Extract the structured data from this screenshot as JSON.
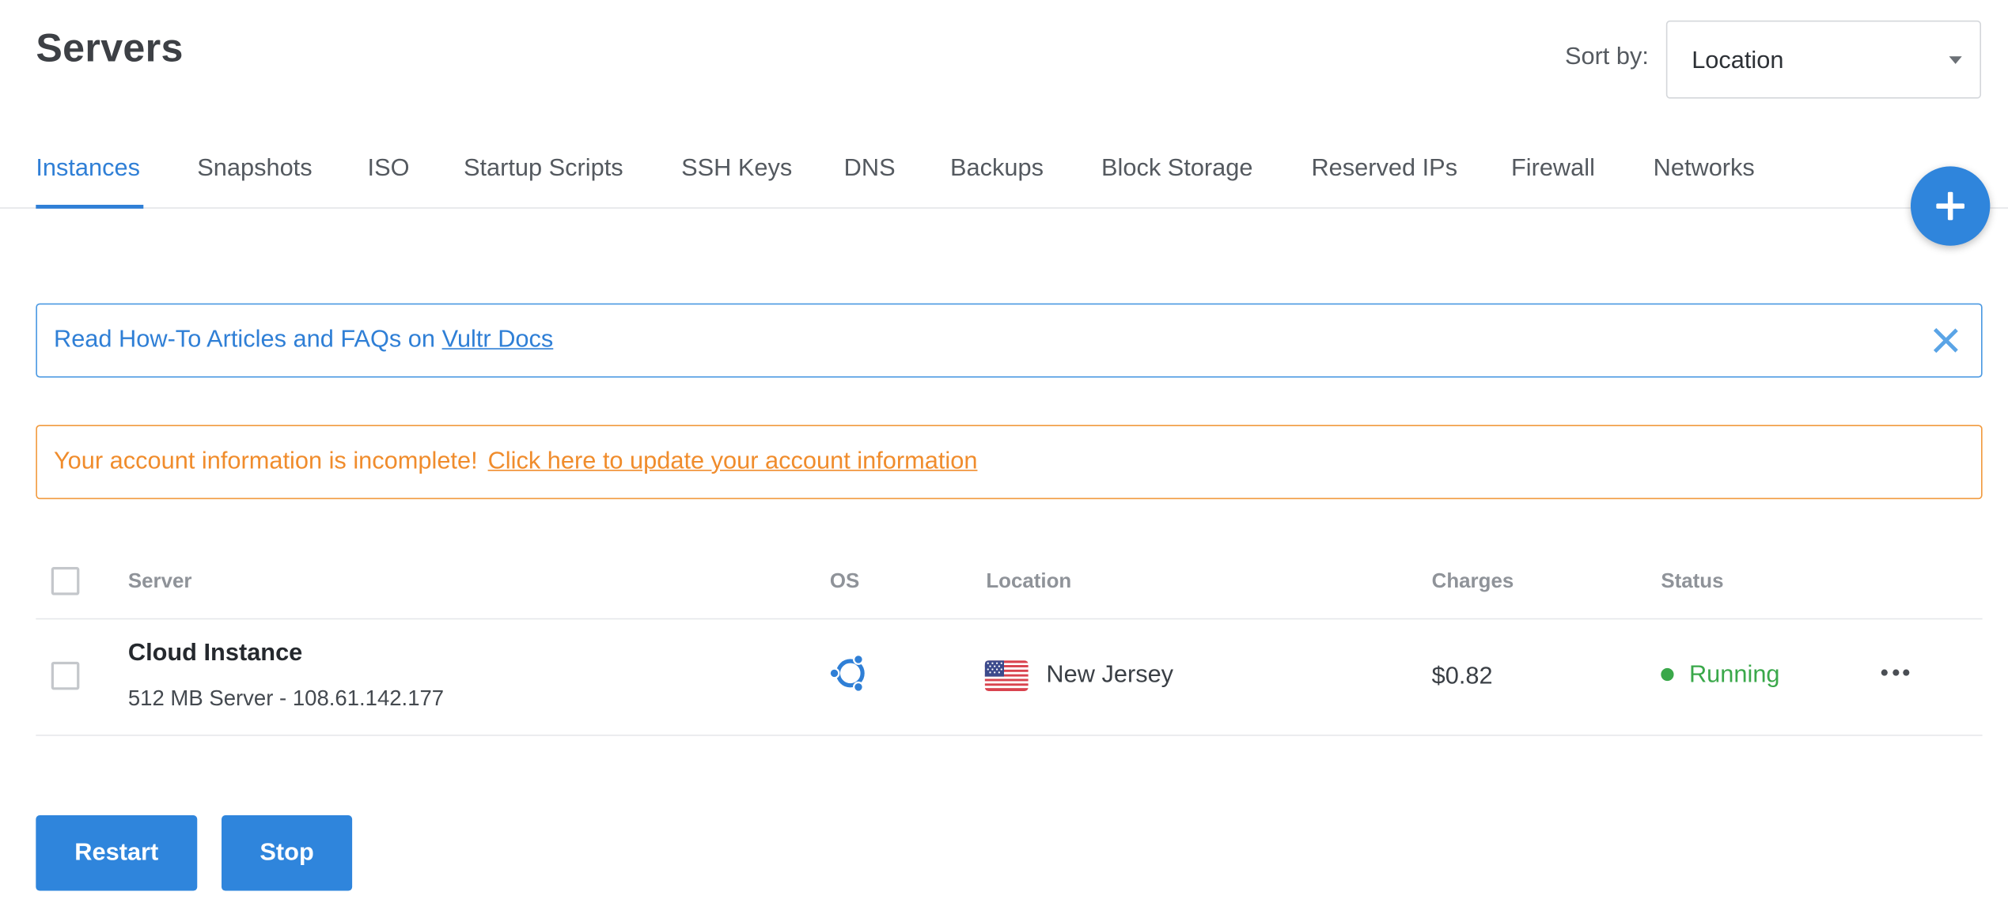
{
  "header": {
    "title": "Servers",
    "sort_label": "Sort by:",
    "sort_value": "Location"
  },
  "tabs": [
    {
      "label": "Instances",
      "active": true
    },
    {
      "label": "Snapshots"
    },
    {
      "label": "ISO"
    },
    {
      "label": "Startup Scripts"
    },
    {
      "label": "SSH Keys"
    },
    {
      "label": "DNS"
    },
    {
      "label": "Backups"
    },
    {
      "label": "Block Storage"
    },
    {
      "label": "Reserved IPs"
    },
    {
      "label": "Firewall"
    },
    {
      "label": "Networks"
    }
  ],
  "fab": {
    "icon": "plus-icon"
  },
  "info_alert": {
    "text": "Read How-To Articles and FAQs on ",
    "link": "Vultr Docs",
    "close_icon": "close-icon"
  },
  "warning_alert": {
    "text": "Your account information is incomplete!",
    "link": "Click here to update your account information"
  },
  "table": {
    "columns": {
      "server": "Server",
      "os": "OS",
      "location": "Location",
      "charges": "Charges",
      "status": "Status"
    },
    "rows": [
      {
        "name": "Cloud Instance",
        "details": "512 MB Server - 108.61.142.177",
        "os_icon": "ubuntu-icon",
        "flag_icon": "us-flag-icon",
        "location": "New Jersey",
        "charges": "$0.82",
        "status": "Running",
        "status_color": "#3aa84a"
      }
    ]
  },
  "actions": {
    "restart": "Restart",
    "stop": "Stop"
  },
  "colors": {
    "accent": "#2f7fd6",
    "warning": "#f08c2c",
    "success": "#3aa84a"
  }
}
